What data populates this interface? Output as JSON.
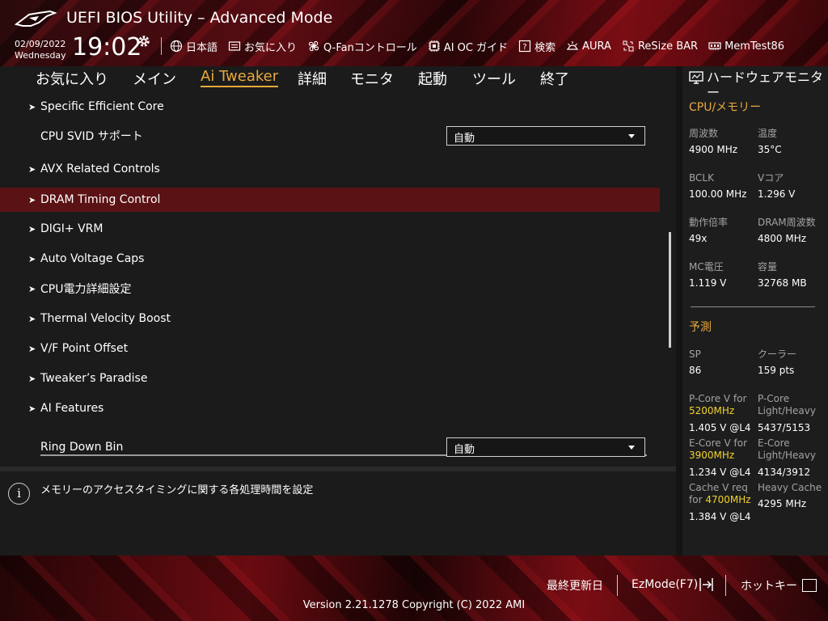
{
  "header": {
    "title": "UEFI BIOS Utility – Advanced Mode",
    "date": "02/09/2022",
    "weekday": "Wednesday",
    "time": "19:02",
    "nav": [
      {
        "icon": "globe-icon",
        "label": "日本語"
      },
      {
        "icon": "favorites-icon",
        "label": "お気に入り"
      },
      {
        "icon": "fan-icon",
        "label": "Q-Fanコントロール"
      },
      {
        "icon": "ai-oc-icon",
        "label": "AI OC ガイド"
      },
      {
        "icon": "help-search-icon",
        "label": "検索"
      },
      {
        "icon": "aura-icon",
        "label": "AURA"
      },
      {
        "icon": "resize-bar-icon",
        "label": "ReSize BAR"
      },
      {
        "icon": "memtest-icon",
        "label": "MemTest86"
      }
    ]
  },
  "menu": {
    "tabs": [
      "お気に入り",
      "メイン",
      "Ai Tweaker",
      "詳細",
      "モニタ",
      "起動",
      "ツール",
      "終了"
    ],
    "active": "Ai Tweaker"
  },
  "settings": {
    "items": [
      {
        "label": "Specific Efficient Core",
        "submenu": true
      },
      {
        "label": "CPU SVID サポート",
        "value": "自動"
      },
      {
        "label": "AVX Related Controls",
        "submenu": true
      },
      {
        "label": "DRAM Timing Control",
        "submenu": true,
        "selected": true
      },
      {
        "label": "DIGI+ VRM",
        "submenu": true
      },
      {
        "label": "Auto Voltage Caps",
        "submenu": true
      },
      {
        "label": "CPU電力詳細設定",
        "submenu": true
      },
      {
        "label": "Thermal Velocity Boost",
        "submenu": true
      },
      {
        "label": "V/F Point Offset",
        "submenu": true
      },
      {
        "label": "Tweaker’s Paradise",
        "submenu": true
      },
      {
        "label": "AI Features",
        "submenu": true
      },
      {
        "label": "Ring Down Bin",
        "value": "自動"
      }
    ]
  },
  "help": {
    "text": "メモリーのアクセスタイミングに関する各処理時間を設定"
  },
  "hw_monitor": {
    "title": "ハードウェアモニター",
    "cpu_section": "CPU/メモリー",
    "cpu": [
      {
        "label": "周波数",
        "value": "4900 MHz"
      },
      {
        "label": "温度",
        "value": "35°C"
      },
      {
        "label": "BCLK",
        "value": "100.00 MHz"
      },
      {
        "label": "Vコア",
        "value": "1.296 V"
      },
      {
        "label": "動作倍率",
        "value": "49x"
      },
      {
        "label": "DRAM周波数",
        "value": "4800 MHz"
      },
      {
        "label": "MC電圧",
        "value": "1.119 V"
      },
      {
        "label": "容量",
        "value": "32768 MB"
      }
    ],
    "predict_section": "予測",
    "sp_label": "SP",
    "sp_value": "86",
    "cooler_label": "クーラー",
    "cooler_value": "159 pts",
    "pcore_v_label": "P-Core V for",
    "pcore_v_freq": "5200MHz",
    "pcore_v_value": "1.405 V @L4",
    "pcore_lh_label1": "P-Core",
    "pcore_lh_label2": "Light/Heavy",
    "pcore_lh_value": "5437/5153",
    "ecore_v_label": "E-Core V for",
    "ecore_v_freq": "3900MHz",
    "ecore_v_value": "1.234 V @L4",
    "ecore_lh_label1": "E-Core",
    "ecore_lh_label2": "Light/Heavy",
    "ecore_lh_value": "4134/3912",
    "cache_v_label": "Cache V req",
    "cache_v_prefix": "for ",
    "cache_v_freq": "4700MHz",
    "cache_v_value": "1.384 V @L4",
    "cache_heavy_label": "Heavy Cache",
    "cache_heavy_value": "4295 MHz"
  },
  "footer": {
    "last_modified": "最終更新日",
    "ezmode": "EzMode(F7)",
    "hotkeys": "ホットキー",
    "version": "Version 2.21.1278 Copyright (C) 2022 AMI"
  },
  "colors": {
    "accent": "#e9a93c",
    "highlight": "#f2d32a",
    "selected_row": "#5a1214"
  }
}
